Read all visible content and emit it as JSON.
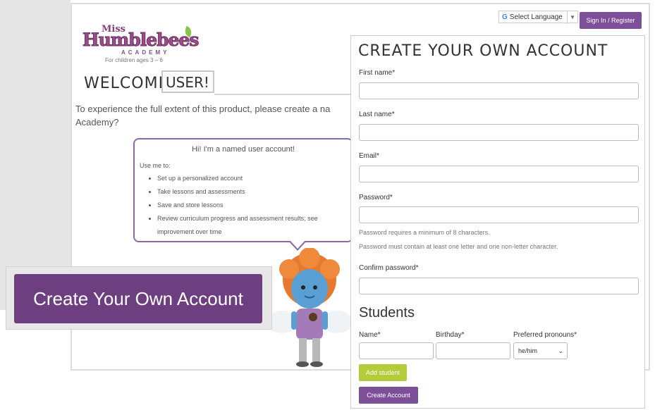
{
  "header": {
    "language_icon": "google-g-icon",
    "language_g": "G",
    "language_label": "Select Language",
    "language_arrow": "▼",
    "signin_label": "Sign In / Register"
  },
  "logo": {
    "miss": "Miss",
    "name": "Humblebees",
    "academy": "ACADEMY",
    "tagline": "For children ages 3 – 6"
  },
  "welcome": {
    "greeting": "WELCOME,",
    "user": "USER!",
    "intro_line1": "To experience the full extent of this product, please create a na",
    "intro_line2": "Academy?"
  },
  "bubble": {
    "title": "Hi! I'm a named user account!",
    "use_me": "Use me to:",
    "items": [
      "Set up a personalized account",
      "Take lessons and assessments",
      "Save and store lessons",
      "Review curriculum progress and assessment results; see improvement over time"
    ]
  },
  "cta": {
    "label": "Create Your Own Account"
  },
  "form": {
    "title": "CREATE YOUR OWN ACCOUNT",
    "first_name_label": "First name*",
    "last_name_label": "Last name*",
    "email_label": "Email*",
    "password_label": "Password*",
    "password_hint1": "Password requires a minimum of 8 characters.",
    "password_hint2": "Password must contain at least one letter and one non-letter character.",
    "confirm_label": "Confirm password*",
    "students_heading": "Students",
    "student_name_label": "Name*",
    "student_birthday_label": "Birthday*",
    "student_pronouns_label": "Preferred pronouns*",
    "pronoun_selected": "he/him",
    "pronoun_caret": "⌄",
    "add_student_label": "Add student",
    "create_account_label": "Create Account"
  },
  "colors": {
    "brand_purple": "#7e4f99",
    "accent_green": "#b5cc3a"
  }
}
